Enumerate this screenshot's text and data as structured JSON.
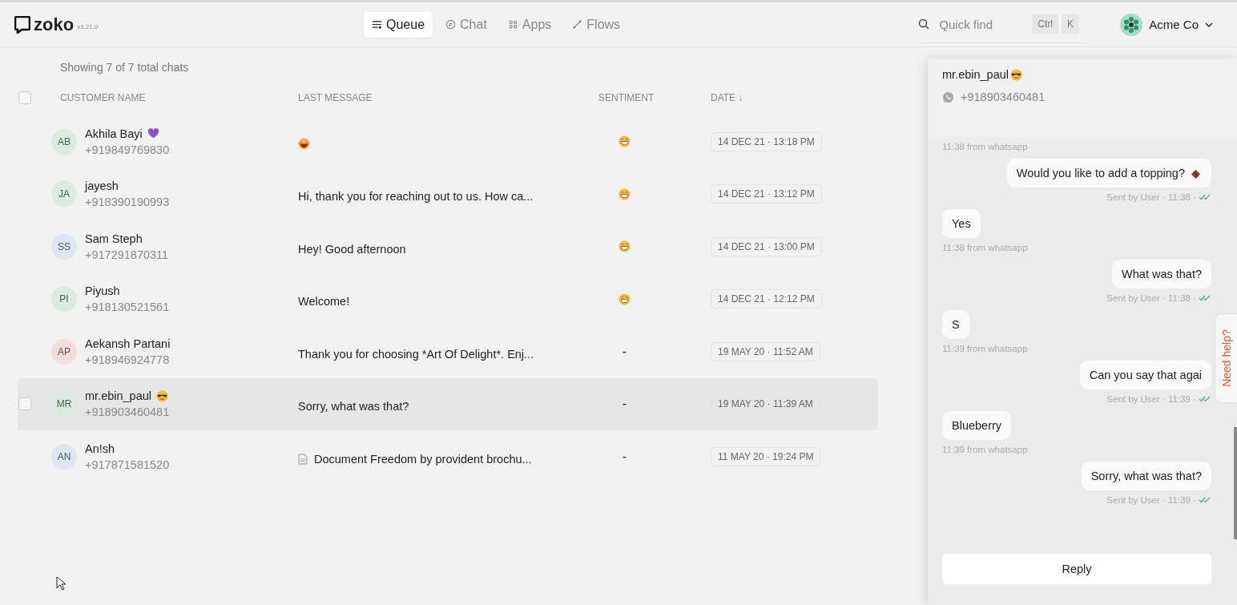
{
  "header": {
    "logo": "zoko",
    "version": "v3.21.0",
    "nav": [
      {
        "label": "Queue",
        "kind": "queue",
        "selected": true
      },
      {
        "label": "Chat",
        "kind": "chat",
        "selected": false
      },
      {
        "label": "Apps",
        "kind": "apps",
        "selected": false
      },
      {
        "label": "Flows",
        "kind": "flows",
        "selected": false
      }
    ],
    "search": {
      "placeholder": "Quick find",
      "keys": [
        "Ctrl",
        "K"
      ]
    },
    "account": "Acme Co"
  },
  "summary": "Showing 7 of 7 total chats",
  "table": {
    "select_all": {
      "checked": false
    },
    "columns": [
      "CUSTOMER NAME",
      "LAST MESSAGE",
      "SENTIMENT",
      "DATE ↓"
    ],
    "rows": [
      {
        "initials": "AB",
        "color": "#dcebe0",
        "name": "Akhila Bayi",
        "kind": "heart",
        "phone": "+919849769830",
        "message": {
          "kind": "emoji"
        },
        "sentiment": {
          "kind": "happy"
        },
        "date": "14 DEC 21 · 13:18 PM",
        "selected": false
      },
      {
        "initials": "JA",
        "color": "#dcebe0",
        "name": "jayesh",
        "phone": "+918390190993",
        "message": {
          "kind": "text",
          "text": "Hi, thank you for reaching out to us. How ca..."
        },
        "sentiment": {
          "kind": "happy"
        },
        "date": "14 DEC 21 · 13:12 PM",
        "selected": false
      },
      {
        "initials": "SS",
        "color": "#dde4f3",
        "name": "Sam Steph",
        "phone": "+917291870311",
        "message": {
          "kind": "text",
          "text": "Hey! Good afternoon"
        },
        "sentiment": {
          "kind": "happy"
        },
        "date": "14 DEC 21 · 13:00 PM",
        "selected": false
      },
      {
        "initials": "PI",
        "color": "#dcebe0",
        "name": "Piyush",
        "phone": "+918130521561",
        "message": {
          "kind": "text",
          "text": "Welcome!"
        },
        "sentiment": {
          "kind": "happy"
        },
        "date": "14 DEC 21 · 12:12 PM",
        "selected": false
      },
      {
        "initials": "AP",
        "color": "#f3dcdc",
        "name": "Aekansh Partani",
        "phone": "+918946924778",
        "message": {
          "kind": "text",
          "text": "Thank you for choosing *Art Of Delight*. Enj..."
        },
        "sentiment": {
          "kind": "text",
          "text": "-"
        },
        "date": "19 MAY 20 · 11:52 AM",
        "selected": false
      },
      {
        "initials": "MR",
        "color": "#dcebe0",
        "name": "mr.ebin_paul",
        "kind": "sunglasses",
        "phone": "+918903460481",
        "message": {
          "kind": "text",
          "text": "Sorry, what was that?"
        },
        "sentiment": {
          "kind": "text",
          "text": "-"
        },
        "date": "19 MAY 20 · 11:39 AM",
        "selected": true
      },
      {
        "initials": "AN",
        "color": "#dde4f3",
        "name": "An!sh",
        "phone": "+917871581520",
        "message": {
          "kind": "document",
          "text": "Document Freedom by provident brochu..."
        },
        "sentiment": {
          "kind": "text",
          "text": "-"
        },
        "date": "11 MAY 20 · 19:24 PM",
        "selected": false
      }
    ]
  },
  "chat": {
    "name": "mr.ebin_paul",
    "kind": "sunglasses",
    "phone": "+918903460481",
    "messages": [
      {
        "kind": "meta_in",
        "meta": "11:38 from whatsapp"
      },
      {
        "kind": "out_emoji",
        "text": "Would you like to add a topping?",
        "meta": "Sent by User · 11:38 ·"
      },
      {
        "kind": "in",
        "text": "Yes",
        "meta": "11:38 from whatsapp"
      },
      {
        "kind": "out",
        "text": "What was that?",
        "meta": "Sent by User · 11:38 ·"
      },
      {
        "kind": "in",
        "text": "S",
        "meta": "11:39 from whatsapp"
      },
      {
        "kind": "out",
        "text": "Can you say that agai",
        "meta": "Sent by User · 11:39 ·"
      },
      {
        "kind": "in",
        "text": "Blueberry",
        "meta": "11:39 from whatsapp"
      },
      {
        "kind": "out",
        "text": "Sorry, what was that?",
        "meta": "Sent by User · 11:39 ·"
      }
    ],
    "reply": "Reply",
    "help": "Need help?"
  }
}
